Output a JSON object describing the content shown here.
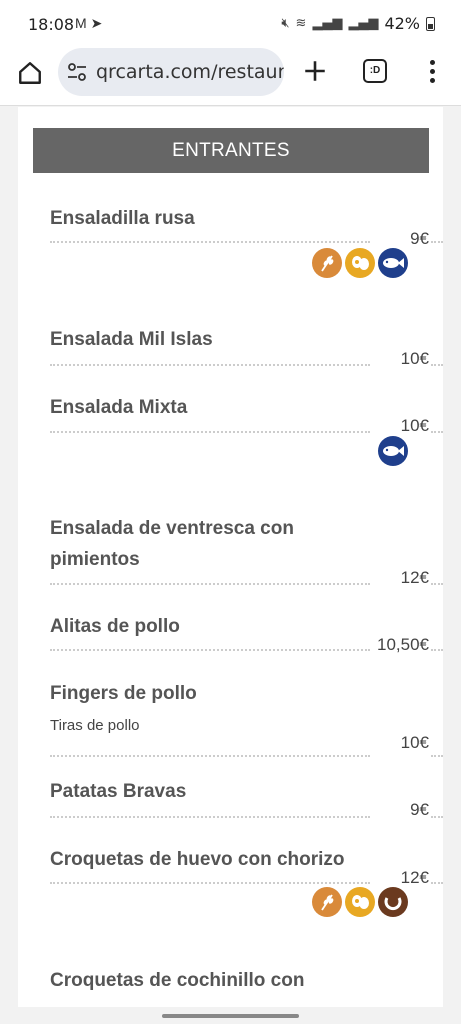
{
  "status_bar": {
    "time": "18:08",
    "battery": "42%",
    "icons": [
      "gmail-icon",
      "telegram-icon",
      "mute-icon",
      "wifi-icon",
      "signal-icon",
      "signal-icon",
      "battery-icon"
    ]
  },
  "browser": {
    "url": "qrcarta.com/restaurant",
    "tabs_label": ":D"
  },
  "menu": {
    "section_title": "ENTRANTES",
    "items": [
      {
        "name": "Ensaladilla rusa",
        "desc": "",
        "price": "9€",
        "allergens": [
          "gluten",
          "egg",
          "fish"
        ]
      },
      {
        "name": "Ensalada Mil Islas",
        "desc": "",
        "price": "10€",
        "allergens": []
      },
      {
        "name": "Ensalada Mixta",
        "desc": "",
        "price": "10€",
        "allergens": [
          "fish"
        ]
      },
      {
        "name": "Ensalada de ventresca con pimientos",
        "desc": "",
        "price": "12€",
        "allergens": []
      },
      {
        "name": "Alitas de pollo",
        "desc": "",
        "price": "10,50€",
        "allergens": []
      },
      {
        "name": "Fingers de pollo",
        "desc": "Tiras de pollo",
        "price": "10€",
        "allergens": []
      },
      {
        "name": "Patatas Bravas",
        "desc": "",
        "price": "9€",
        "allergens": []
      },
      {
        "name": "Croquetas de huevo con chorizo",
        "desc": "",
        "price": "12€",
        "allergens": [
          "gluten",
          "egg",
          "milk"
        ]
      },
      {
        "name": "Croquetas de cochinillo con",
        "desc": "",
        "price": "",
        "allergens": []
      }
    ]
  },
  "colors": {
    "gluten": "#d98a3a",
    "egg": "#e8a823",
    "fish": "#1f3f8c",
    "milk": "#6b3a1f",
    "header_bg": "#666666"
  }
}
